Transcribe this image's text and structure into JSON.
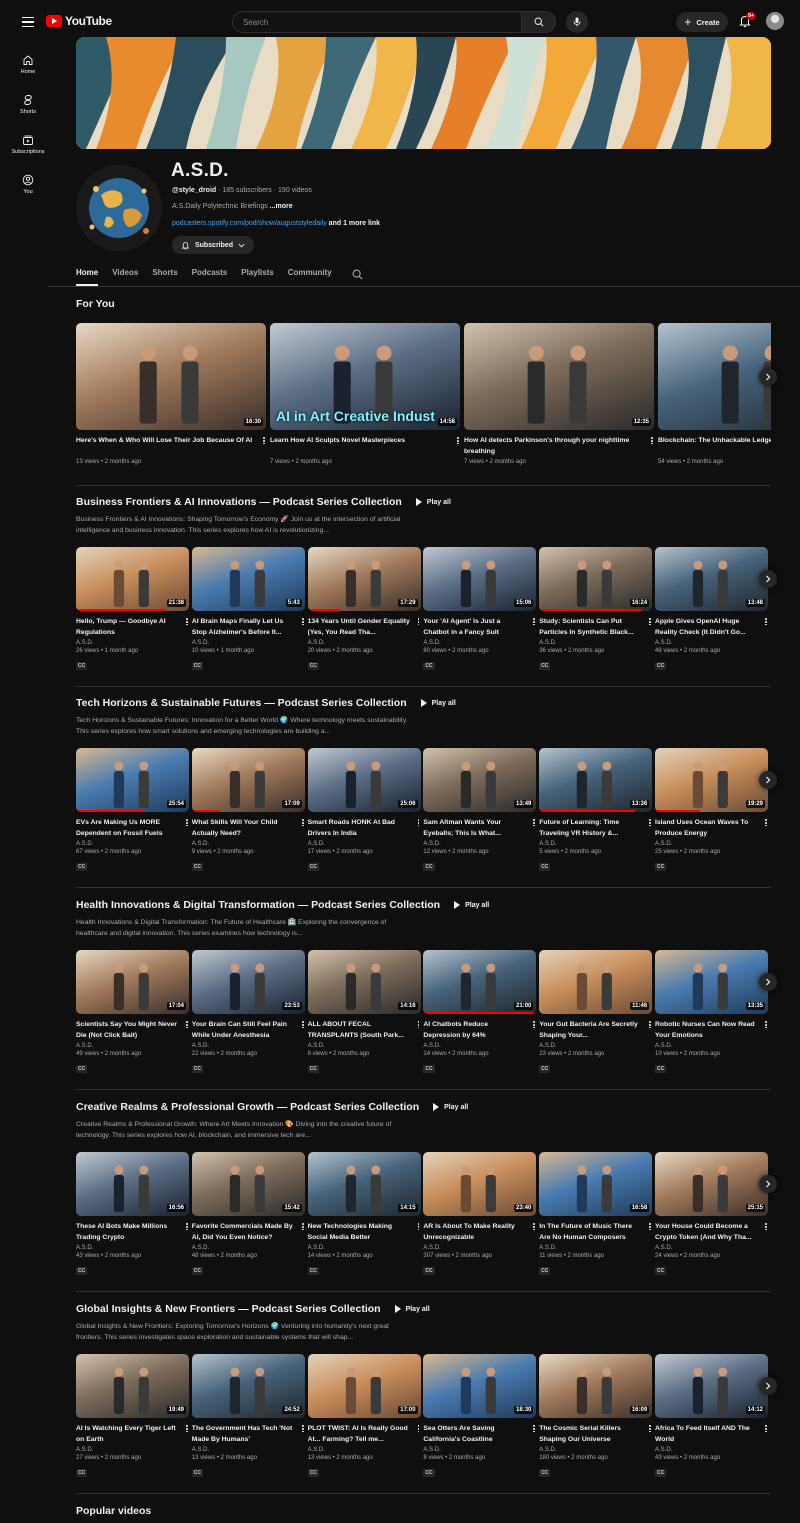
{
  "header": {
    "logo_text": "YouTube",
    "search_placeholder": "Search",
    "create_label": "Create",
    "notif_count": "9+"
  },
  "sidebar": [
    {
      "label": "Home",
      "icon": "home-icon"
    },
    {
      "label": "Shorts",
      "icon": "shorts-icon"
    },
    {
      "label": "Subscriptions",
      "icon": "subscriptions-icon"
    },
    {
      "label": "You",
      "icon": "you-icon"
    }
  ],
  "channel": {
    "name": "A.S.D.",
    "handle": "@style_droid",
    "stats": " · 185 subscribers · 190 videos",
    "description": "A.S.Daily Polytechnic Briefings ",
    "more": "...more",
    "link": "podcasters.spotify.com/pod/show/auguststyledaily",
    "more_links": " and 1 more link",
    "subscribed_label": "Subscribed"
  },
  "tabs": [
    "Home",
    "Videos",
    "Shorts",
    "Podcasts",
    "Playlists",
    "Community"
  ],
  "for_you": {
    "title": "For You",
    "videos": [
      {
        "title": "Here's When & Who Will Lose Their Job Because Of AI",
        "meta": "13 views • 2 months ago",
        "duration": "16:30",
        "overlay": ""
      },
      {
        "title": "Learn How AI Sculpts Novel Masterpieces",
        "meta": "7 views • 2 months ago",
        "duration": "14:58",
        "overlay": "AI in Art Creative Indust"
      },
      {
        "title": "How AI detects Parkinson's through your nighttime breathing",
        "meta": "7 views • 2 months ago",
        "duration": "12:35",
        "overlay": ""
      },
      {
        "title": "Blockchain: The Unhackable Ledger Finance",
        "meta": "54 views • 2 months ago",
        "duration": "",
        "overlay": ""
      }
    ]
  },
  "playlists": [
    {
      "title": "Business Frontiers & AI Innovations — Podcast Series Collection",
      "play_all": "Play all",
      "desc": "Business Frontiers & AI Innovations: Shaping Tomorrow's Economy 🚀 Join us at the intersection of artificial intelligence and business innovation. This series explores how AI is revolutionizing...",
      "videos": [
        {
          "title": "Hello, Trump — Goodbye AI Regulations",
          "channel": "A.S.D.",
          "meta": "26 views • 1 month ago",
          "duration": "21:38"
        },
        {
          "title": "AI Brain Maps Finally Let Us Stop Alzheimer's Before It...",
          "channel": "A.S.D.",
          "meta": "10 views • 1 month ago",
          "duration": "5:43"
        },
        {
          "title": "134 Years Until Gender Equality (Yes, You Read Tha...",
          "channel": "A.S.D.",
          "meta": "20 views • 2 months ago",
          "duration": "17:29"
        },
        {
          "title": "Your 'AI Agent' Is Just a Chatbot in a Fancy Suit",
          "channel": "A.S.D.",
          "meta": "80 views • 2 months ago",
          "duration": "15:06"
        },
        {
          "title": "Study: Scientists Can Put Particles In Synthetic Black...",
          "channel": "A.S.D.",
          "meta": "36 views • 2 months ago",
          "duration": "16:24"
        },
        {
          "title": "Apple Gives OpenAI Huge Reality Check (It Didn't Go...",
          "channel": "A.S.D.",
          "meta": "48 views • 2 months ago",
          "duration": "13:48"
        }
      ]
    },
    {
      "title": "Tech Horizons & Sustainable Futures — Podcast Series Collection",
      "play_all": "Play all",
      "desc": "Tech Horizons & Sustainable Futures: Innovation for a Better World 🌍 Where technology meets sustainability. This series explores how smart solutions and emerging technologies are building a...",
      "videos": [
        {
          "title": "EVs Are Making Us MORE Dependent on Fossil Fuels",
          "channel": "A.S.D.",
          "meta": "67 views • 2 months ago",
          "duration": "25:54"
        },
        {
          "title": "What Skills Will Your Child Actually Need?",
          "channel": "A.S.D.",
          "meta": "9 views • 2 months ago",
          "duration": "17:09"
        },
        {
          "title": "Smart Roads HONK At Bad Drivers In India",
          "channel": "A.S.D.",
          "meta": "17 views • 2 months ago",
          "duration": "25:06"
        },
        {
          "title": "Sam Altman Wants Your Eyeballs; This Is What...",
          "channel": "A.S.D.",
          "meta": "12 views • 2 months ago",
          "duration": "13:49"
        },
        {
          "title": "Future of Learning: Time Traveling VR History &...",
          "channel": "A.S.D.",
          "meta": "5 views • 2 months ago",
          "duration": "13:36"
        },
        {
          "title": "Island Uses Ocean Waves To Produce Energy",
          "channel": "A.S.D.",
          "meta": "25 views • 2 months ago",
          "duration": "19:29"
        }
      ]
    },
    {
      "title": "Health Innovations & Digital Transformation — Podcast Series Collection",
      "play_all": "Play all",
      "desc": "Health Innovations & Digital Transformation: The Future of Healthcare 🏥 Exploring the convergence of healthcare and digital innovation. This series examines how technology is...",
      "videos": [
        {
          "title": "Scientists Say You Might Never Die (Not Click Bait)",
          "channel": "A.S.D.",
          "meta": "49 views • 2 months ago",
          "duration": "17:04"
        },
        {
          "title": "Your Brain Can Still Feel Pain While Under Anesthesia",
          "channel": "A.S.D.",
          "meta": "22 views • 2 months ago",
          "duration": "23:53"
        },
        {
          "title": "ALL ABOUT FECAL TRANSPLANTS (South Park...",
          "channel": "A.S.D.",
          "meta": "8 views • 2 months ago",
          "duration": "14:16"
        },
        {
          "title": "AI Chatbots Reduce Depression by 64%",
          "channel": "A.S.D.",
          "meta": "14 views • 2 months ago",
          "duration": "21:00"
        },
        {
          "title": "Your Gut Bacteria Are Secretly Shaping Your...",
          "channel": "A.S.D.",
          "meta": "23 views • 2 months ago",
          "duration": "11:46"
        },
        {
          "title": "Robotic Nurses Can Now Read Your Emotions",
          "channel": "A.S.D.",
          "meta": "10 views • 2 months ago",
          "duration": "13:35"
        }
      ]
    },
    {
      "title": "Creative Realms & Professional Growth — Podcast Series Collection",
      "play_all": "Play all",
      "desc": "Creative Realms & Professional Growth: Where Art Meets Innovation 🎨 Diving into the creative future of technology. This series explores how AI, blockchain, and immersive tech are...",
      "videos": [
        {
          "title": "These AI Bots Make Millions Trading Crypto",
          "channel": "A.S.D.",
          "meta": "43 views • 2 months ago",
          "duration": "16:56"
        },
        {
          "title": "Favorite Commercials Made By AI, Did You Even Notice?",
          "channel": "A.S.D.",
          "meta": "48 views • 2 months ago",
          "duration": "15:42"
        },
        {
          "title": "New Technologies Making Social Media Better",
          "channel": "A.S.D.",
          "meta": "14 views • 2 months ago",
          "duration": "14:15"
        },
        {
          "title": "AR Is About To Make Reality Unrecognizable",
          "channel": "A.S.D.",
          "meta": "307 views • 2 months ago",
          "duration": "23:40"
        },
        {
          "title": "In The Future of Music There Are No Human Composers",
          "channel": "A.S.D.",
          "meta": "11 views • 2 months ago",
          "duration": "16:58"
        },
        {
          "title": "Your House Could Become a Crypto Token (And Why Tha...",
          "channel": "A.S.D.",
          "meta": "24 views • 2 months ago",
          "duration": "25:15"
        }
      ]
    },
    {
      "title": "Global Insights & New Frontiers — Podcast Series Collection",
      "play_all": "Play all",
      "desc": "Global Insights & New Frontiers: Exploring Tomorrow's Horizons 🌍 Venturing into humanity's next great frontiers. This series investigates space exploration and sustainable systems that will shap...",
      "videos": [
        {
          "title": "AI Is Watching Every Tiger Left on Earth",
          "channel": "A.S.D.",
          "meta": "27 views • 2 months ago",
          "duration": "19:49"
        },
        {
          "title": "The Government Has Tech 'Not Made By Humans'",
          "channel": "A.S.D.",
          "meta": "13 views • 2 months ago",
          "duration": "24:52"
        },
        {
          "title": "PLOT TWIST: AI Is Really Good At... Farming? Tell me...",
          "channel": "A.S.D.",
          "meta": "13 views • 2 months ago",
          "duration": "17:00"
        },
        {
          "title": "Sea Otters Are Saving California's Coastline",
          "channel": "A.S.D.",
          "meta": "8 views • 2 months ago",
          "duration": "18:30"
        },
        {
          "title": "The Cosmic Serial Killers Shaping Our Universe",
          "channel": "A.S.D.",
          "meta": "180 views • 2 months ago",
          "duration": "16:09"
        },
        {
          "title": "Africa To Feed Itself AND The World",
          "channel": "A.S.D.",
          "meta": "43 views • 2 months ago",
          "duration": "14:12"
        }
      ]
    }
  ],
  "cc_label": "CC",
  "popular_title": "Popular videos",
  "colors": {
    "accent": "#ff0000",
    "link": "#3ea6ff",
    "background": "#0f0f0f"
  }
}
